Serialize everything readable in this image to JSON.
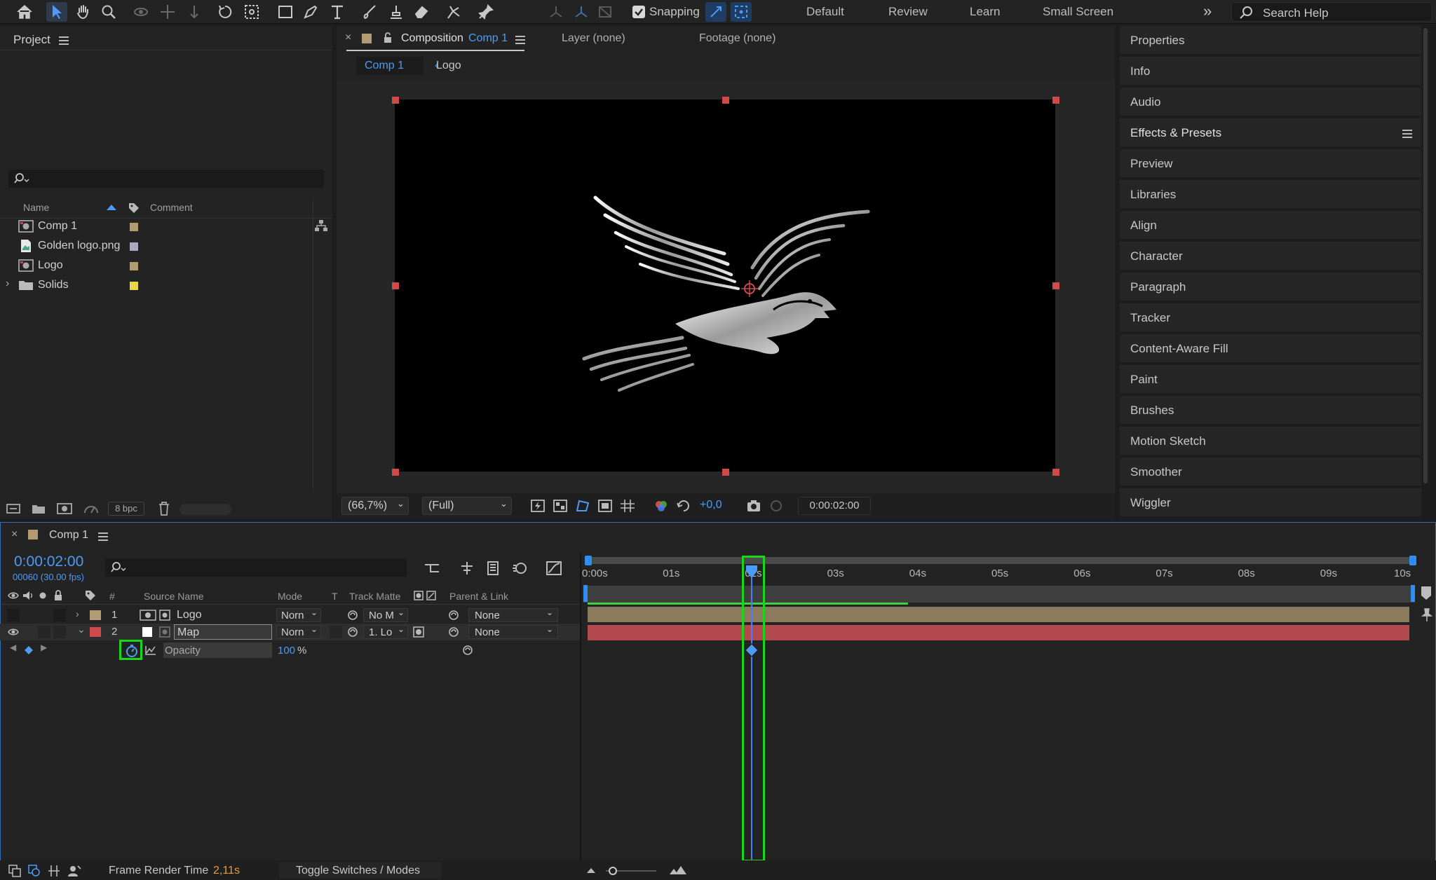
{
  "toolbar": {
    "snapping_label": "Snapping",
    "workspaces": [
      "Default",
      "Review",
      "Learn",
      "Small Screen"
    ],
    "search_placeholder": "Search Help"
  },
  "project": {
    "title": "Project",
    "columns": {
      "name": "Name",
      "comment": "Comment"
    },
    "items": [
      {
        "name": "Comp 1",
        "type": "composition",
        "color": "#b29a72"
      },
      {
        "name": "Golden logo.png",
        "type": "image",
        "color": "#a9a6cf"
      },
      {
        "name": "Logo",
        "type": "composition",
        "color": "#b29a72"
      },
      {
        "name": "Solids",
        "type": "folder",
        "color": "#e8d74a"
      }
    ],
    "bit_depth": "8 bpc"
  },
  "composition_panel": {
    "tab_prefix": "Composition",
    "tab_comp": "Comp 1",
    "layer_tab": "Layer (none)",
    "footage_tab": "Footage (none)",
    "breadcrumb": [
      "Comp 1",
      "Logo"
    ],
    "zoom": "(66,7%)",
    "resolution": "(Full)",
    "exposure": "+0,0",
    "timecode": "0:00:02:00"
  },
  "right_panels": [
    "Properties",
    "Info",
    "Audio",
    "Effects & Presets",
    "Preview",
    "Libraries",
    "Align",
    "Character",
    "Paragraph",
    "Tracker",
    "Content-Aware Fill",
    "Paint",
    "Brushes",
    "Motion Sketch",
    "Smoother",
    "Wiggler"
  ],
  "timeline": {
    "comp_name": "Comp 1",
    "current_time": "0:00:02:00",
    "frame_info": "00060 (30.00 fps)",
    "columns": {
      "num": "#",
      "source": "Source Name",
      "mode": "Mode",
      "t": "T",
      "track_matte": "Track Matte",
      "parent": "Parent & Link"
    },
    "layers": [
      {
        "num": "1",
        "name": "Logo",
        "mode": "Norn",
        "matte": "No M",
        "parent": "None",
        "color": "#b29a72",
        "bar_color": "#8c7a5d"
      },
      {
        "num": "2",
        "name": "Map",
        "mode": "Norn",
        "matte": "1. Lo",
        "parent": "None",
        "color": "#d04a4a",
        "bar_color": "#b24a4f"
      }
    ],
    "property": {
      "name": "Opacity",
      "value": "100",
      "unit": "%"
    },
    "ruler": [
      "0:00s",
      "01s",
      "03s",
      "04s",
      "05s",
      "06s",
      "07s",
      "08s",
      "09s",
      "10s"
    ],
    "playhead_label": "02s",
    "work_area_end_seconds": 3.9,
    "playhead_seconds": 2.0,
    "frame_render_label": "Frame Render Time",
    "frame_render_value": "2,11s",
    "toggle_label": "Toggle Switches / Modes"
  }
}
